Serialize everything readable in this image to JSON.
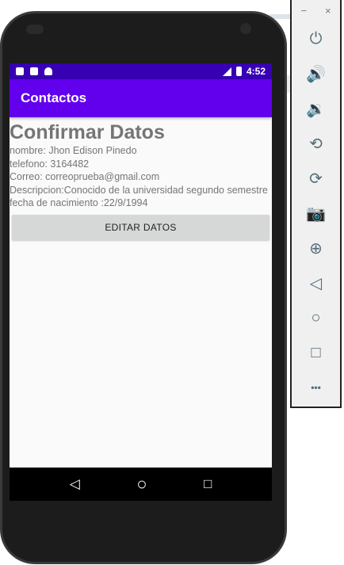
{
  "status_bar": {
    "time": "4:52",
    "icons": [
      "gmail-icon",
      "sd-card-icon",
      "android-icon",
      "lte-signal-icon",
      "battery-charging-icon"
    ]
  },
  "app_bar": {
    "title": "Contactos"
  },
  "content": {
    "heading": "Confirmar Datos",
    "lines": [
      "nombre: Jhon Edison Pinedo",
      "telefono: 3164482",
      "Correo: correoprueba@gmail.com",
      "Descripcion:Conocido de la universidad segundo semestre",
      "fecha de nacimiento :22/9/1994"
    ],
    "edit_button": "EDITAR DATOS"
  },
  "nav_bar": {
    "back": "◁",
    "home": "○",
    "recents": "□"
  },
  "emulator_panel": {
    "minimize": "−",
    "close": "×",
    "buttons": [
      {
        "name": "power",
        "glyph": "⏻"
      },
      {
        "name": "volume-up",
        "glyph": "🔊"
      },
      {
        "name": "volume-down",
        "glyph": "🔉"
      },
      {
        "name": "rotate-left",
        "glyph": "⟲"
      },
      {
        "name": "rotate-right",
        "glyph": "⟳"
      },
      {
        "name": "screenshot",
        "glyph": "📷"
      },
      {
        "name": "zoom",
        "glyph": "⊕"
      },
      {
        "name": "back",
        "glyph": "◁"
      },
      {
        "name": "home",
        "glyph": "○"
      },
      {
        "name": "overview",
        "glyph": "□"
      },
      {
        "name": "more",
        "glyph": "•••"
      }
    ]
  },
  "colors": {
    "status_bar": "#3700b3",
    "app_bar": "#6200ee",
    "button": "#d6d7d7"
  }
}
